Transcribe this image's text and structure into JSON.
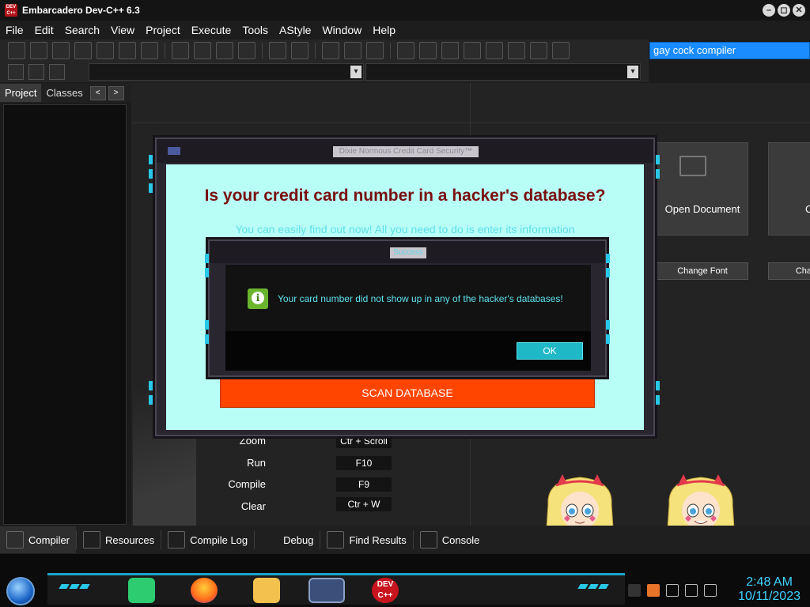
{
  "window": {
    "title": "Embarcadero Dev-C++ 6.3",
    "app_icon_text": "DEV C++",
    "controls": [
      "–",
      "◻",
      "✕"
    ]
  },
  "menu": [
    "File",
    "Edit",
    "Search",
    "View",
    "Project",
    "Execute",
    "Tools",
    "AStyle",
    "Window",
    "Help"
  ],
  "search": {
    "value": "gay cock compiler"
  },
  "left_panel": {
    "tabs": [
      "Project",
      "Classes"
    ],
    "active_tab": "Project",
    "nav_prev": "<",
    "nav_next": ">"
  },
  "combo_arrow": "▾",
  "welcome": {
    "tiles": [
      {
        "label": "Open Document"
      },
      {
        "label": "C"
      }
    ],
    "buttons": [
      {
        "label": "Change Font"
      },
      {
        "label": "Cha"
      }
    ],
    "shortcuts": [
      {
        "label": "Zoom",
        "key": "Ctr + Scroll"
      },
      {
        "label": "Run",
        "key": "F10"
      },
      {
        "label": "Compile",
        "key": "F9"
      },
      {
        "label": "Clear",
        "key": "Ctr + W"
      }
    ]
  },
  "bottom_tabs": [
    "Compiler",
    "Resources",
    "Compile Log",
    "Debug",
    "Find Results",
    "Console"
  ],
  "main_dialog": {
    "title": "Dixie Normous Credit Card Security™",
    "heading": "Is your credit card number in a hacker's database?",
    "subtext": "You can easily find out now! All you need to do is enter its information",
    "scan_button": "SCAN DATABASE"
  },
  "success_dialog": {
    "title": "Success",
    "icon_glyph": "i",
    "message": "Your card number did not show up in any of the hacker's databases!",
    "ok_button": "OK"
  },
  "taskbar": {
    "dev_app_label": "DEV C++",
    "clock": {
      "time": "2:48 AM",
      "date": "10/11/2023"
    }
  },
  "colors": {
    "accent_cyan": "#29c8e8",
    "dialog_bg": "#b9fdf7",
    "heading_red": "#7a1010",
    "scan_orange": "#ff4500",
    "search_blue": "#1a8cff"
  }
}
